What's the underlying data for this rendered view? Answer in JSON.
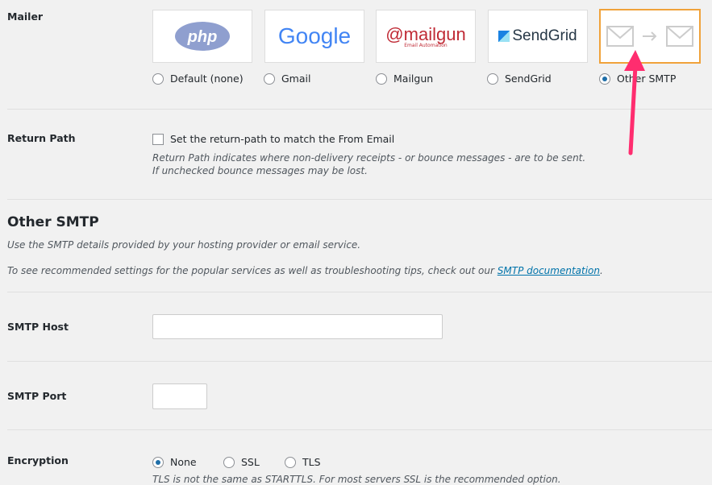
{
  "mailer": {
    "label": "Mailer",
    "options": [
      {
        "label": "Default (none)",
        "logo": "php",
        "checked": false
      },
      {
        "label": "Gmail",
        "logo": "Google",
        "checked": false
      },
      {
        "label": "Mailgun",
        "logo": "@mailgun",
        "logo_sub": "Email Automation",
        "checked": false
      },
      {
        "label": "SendGrid",
        "logo": "SendGrid",
        "checked": false
      },
      {
        "label": "Other SMTP",
        "logo": "envelope-arrow-envelope",
        "checked": true
      }
    ]
  },
  "return_path": {
    "label": "Return Path",
    "checkbox_label": "Set the return-path to match the From Email",
    "help_line1": "Return Path indicates where non-delivery receipts - or bounce messages - are to be sent.",
    "help_line2": "If unchecked bounce messages may be lost."
  },
  "other_smtp": {
    "heading": "Other SMTP",
    "desc1": "Use the SMTP details provided by your hosting provider or email service.",
    "desc2_prefix": "To see recommended settings for the popular services as well as troubleshooting tips, check out our ",
    "desc2_link": "SMTP documentation",
    "desc2_suffix": "."
  },
  "smtp_host": {
    "label": "SMTP Host",
    "value": ""
  },
  "smtp_port": {
    "label": "SMTP Port",
    "value": ""
  },
  "encryption": {
    "label": "Encryption",
    "options": [
      {
        "label": "None",
        "checked": true
      },
      {
        "label": "SSL",
        "checked": false
      },
      {
        "label": "TLS",
        "checked": false
      }
    ],
    "help_partial": "TLS is not the same as STARTTLS. For most servers SSL is the recommended option."
  },
  "colors": {
    "accent": "#f0a23a",
    "annotation": "#ff2d6f",
    "link": "#0073aa"
  }
}
